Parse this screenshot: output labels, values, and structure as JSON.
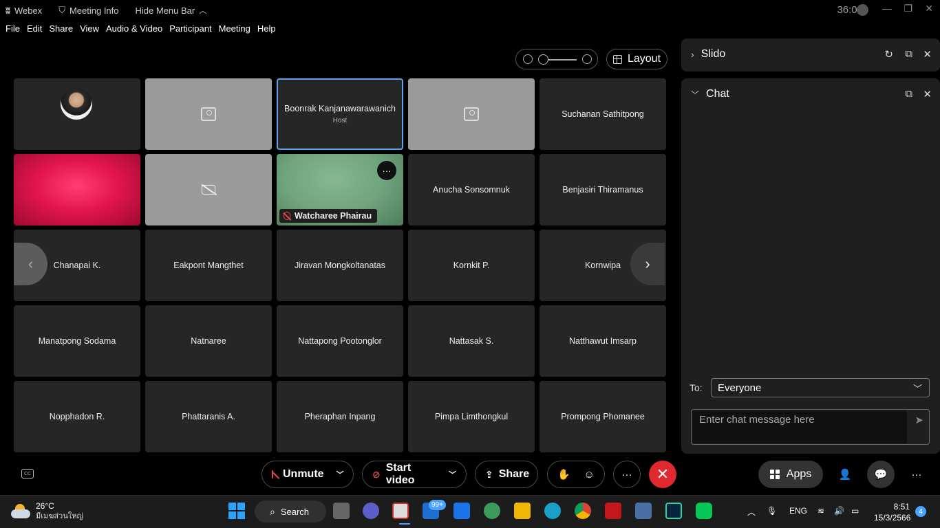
{
  "titlebar": {
    "app_name": "Webex",
    "meeting_info": "Meeting Info",
    "hide_menu_bar": "Hide Menu Bar",
    "timer": "36:02"
  },
  "menu": [
    "File",
    "Edit",
    "Share",
    "View",
    "Audio & Video",
    "Participant",
    "Meeting",
    "Help"
  ],
  "layout_button": "Layout",
  "tiles": [
    {
      "name": "",
      "type": "avatar"
    },
    {
      "name": "",
      "type": "grey-cam"
    },
    {
      "name": "Boonrak Kanjanawarawanich",
      "sub": "Host",
      "type": "host"
    },
    {
      "name": "",
      "type": "grey-cam"
    },
    {
      "name": "Suchanan Sathitpong",
      "type": "name"
    },
    {
      "name": "",
      "type": "pink"
    },
    {
      "name": "",
      "type": "grey-nocam"
    },
    {
      "name": "Watcharee Phairau",
      "type": "video"
    },
    {
      "name": "Anucha Sonsomnuk",
      "type": "name"
    },
    {
      "name": "Benjasiri Thiramanus",
      "type": "name"
    },
    {
      "name": "Chanapai K.",
      "type": "name"
    },
    {
      "name": "Eakpont Mangthet",
      "type": "name"
    },
    {
      "name": "Jiravan Mongkoltanatas",
      "type": "name"
    },
    {
      "name": "Kornkit P.",
      "type": "name"
    },
    {
      "name": "Kornwipa",
      "type": "name"
    },
    {
      "name": "Manatpong Sodama",
      "type": "name"
    },
    {
      "name": "Natnaree",
      "type": "name"
    },
    {
      "name": "Nattapong Pootonglor",
      "type": "name"
    },
    {
      "name": "Nattasak S.",
      "type": "name"
    },
    {
      "name": "Natthawut Imsarp",
      "type": "name"
    },
    {
      "name": "Nopphadon R.",
      "type": "name"
    },
    {
      "name": "Phattaranis A.",
      "type": "name"
    },
    {
      "name": "Pheraphan Inpang",
      "type": "name"
    },
    {
      "name": "Pimpa Limthongkul",
      "type": "name"
    },
    {
      "name": "Prompong Phomanee",
      "type": "name"
    }
  ],
  "panel": {
    "slido_title": "Slido",
    "chat_title": "Chat",
    "to_label": "To:",
    "to_value": "Everyone",
    "chat_placeholder": "Enter chat message here"
  },
  "controls": {
    "unmute": "Unmute",
    "start_video": "Start video",
    "share": "Share",
    "more": "···",
    "apps": "Apps"
  },
  "taskbar": {
    "temperature": "26°C",
    "weather_desc": "มีเมฆส่วนใหญ่",
    "search": "Search",
    "mail_badge": "99+",
    "language": "ENG",
    "time": "8:51",
    "date": "15/3/2566",
    "notifications": "4"
  },
  "colors": {
    "accent_blue": "#5aa6ee",
    "end_red": "#e0282e",
    "tile_bg": "#262626",
    "panel_bg": "#1f1f1f"
  }
}
